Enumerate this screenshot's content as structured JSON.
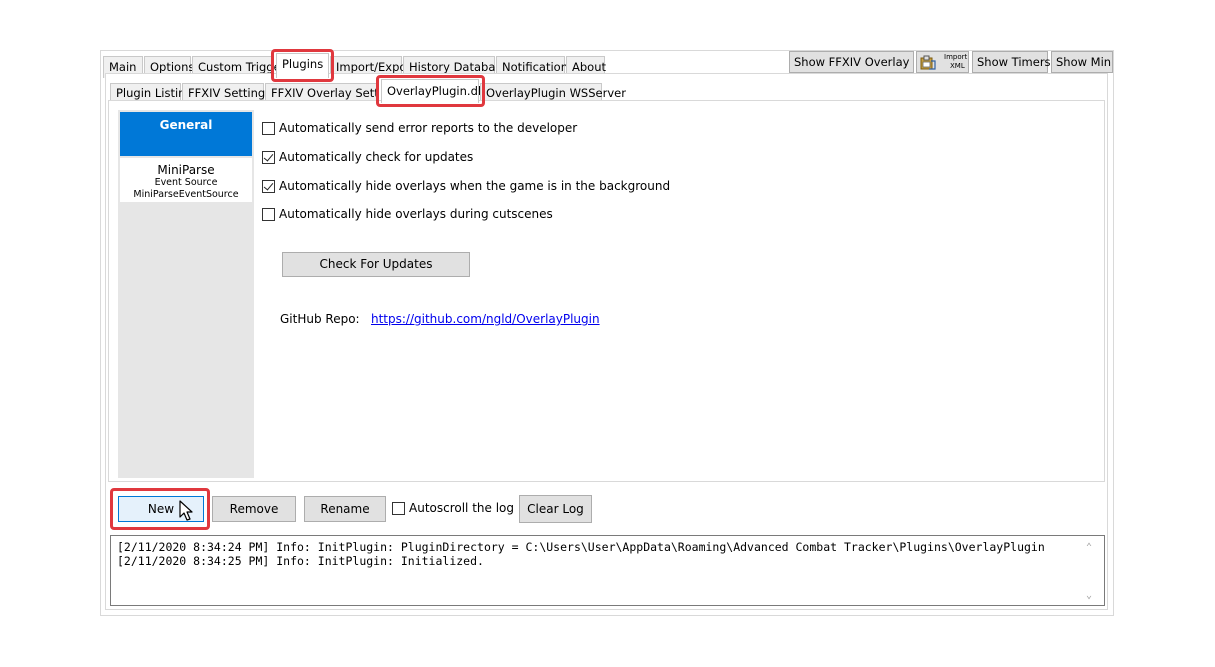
{
  "main_tabs": [
    {
      "label": "Main"
    },
    {
      "label": "Options"
    },
    {
      "label": "Custom Triggers"
    },
    {
      "label": "Plugins"
    },
    {
      "label": "Import/Export"
    },
    {
      "label": "History Database"
    },
    {
      "label": "Notifications"
    },
    {
      "label": "About"
    }
  ],
  "toolbar": {
    "show_overlay": "Show FFXIV Overlay",
    "import_xml_line1": "Import",
    "import_xml_line2": "XML",
    "show_timers": "Show Timers",
    "show_mini": "Show Mini"
  },
  "sub_tabs": [
    {
      "label": "Plugin Listing"
    },
    {
      "label": "FFXIV Settings"
    },
    {
      "label": "FFXIV Overlay Settings"
    },
    {
      "label": "OverlayPlugin.dll"
    },
    {
      "label": "OverlayPlugin WSServer"
    }
  ],
  "left_list": {
    "general": "General",
    "miniparse_title": "MiniParse",
    "miniparse_type": "Event Source",
    "miniparse_name": "MiniParseEventSource"
  },
  "settings": {
    "checkboxes": [
      {
        "label": "Automatically send error reports to the developer",
        "checked": false
      },
      {
        "label": "Automatically check for updates",
        "checked": true
      },
      {
        "label": "Automatically hide overlays when the game is in the background",
        "checked": true
      },
      {
        "label": "Automatically hide overlays during cutscenes",
        "checked": false
      }
    ],
    "check_updates_button": "Check For Updates",
    "github_label": "GitHub Repo:",
    "github_url": "https://github.com/ngld/OverlayPlugin"
  },
  "actions": {
    "new": "New",
    "remove": "Remove",
    "rename": "Rename",
    "autoscroll": "Autoscroll the log",
    "autoscroll_checked": false,
    "clear_log": "Clear Log"
  },
  "log": {
    "line1": "[2/11/2020 8:34:24 PM] Info: InitPlugin: PluginDirectory = C:\\Users\\User\\AppData\\Roaming\\Advanced Combat Tracker\\Plugins\\OverlayPlugin",
    "line2": "[2/11/2020 8:34:25 PM] Info: InitPlugin: Initialized."
  }
}
